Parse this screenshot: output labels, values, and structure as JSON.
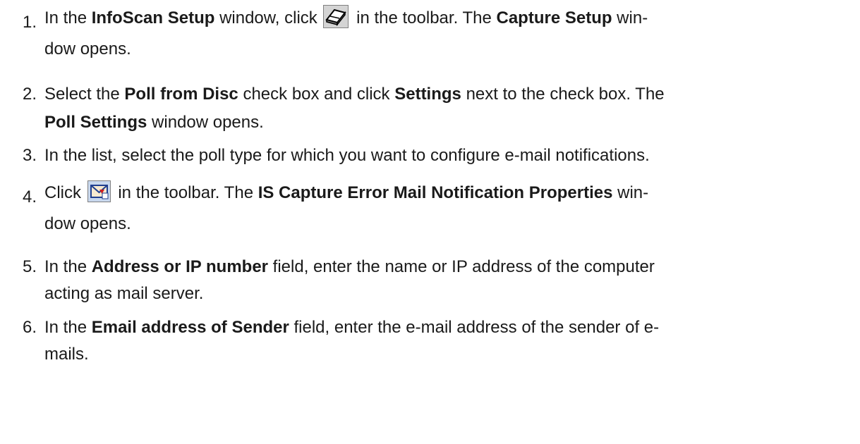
{
  "steps": [
    {
      "number": "1.",
      "parts": {
        "t1": "In the ",
        "b1": "InfoScan Setup",
        "t2": " window, click ",
        "t3": " in the toolbar. The ",
        "b2": "Capture Setup",
        "t4": " win-",
        "t5": "dow opens."
      },
      "icon": "scan-setup-icon"
    },
    {
      "number": "2.",
      "parts": {
        "t1": "Select the ",
        "b1": "Poll from Disc",
        "t2": " check box and click ",
        "b2": "Settings",
        "t3": " next to the check box. The",
        "b3": "Poll Settings",
        "t4": " window opens."
      }
    },
    {
      "number": "3.",
      "parts": {
        "t1": "In the list, select the poll type for which you want to configure e-mail notifications."
      }
    },
    {
      "number": "4.",
      "parts": {
        "t1": "Click ",
        "t2": " in the toolbar. The ",
        "b1": "IS Capture Error Mail Notification Properties",
        "t3": " win-",
        "t4": "dow opens."
      },
      "icon": "mail-notification-icon"
    },
    {
      "number": "5.",
      "parts": {
        "t1": "In the ",
        "b1": "Address or IP number",
        "t2": " field, enter the name or IP address of the computer",
        "t3": "acting as mail server."
      }
    },
    {
      "number": "6.",
      "parts": {
        "t1": "In the ",
        "b1": "Email address of Sender",
        "t2": " field, enter the e-mail address of the sender of e-",
        "t3": "mails."
      }
    }
  ]
}
